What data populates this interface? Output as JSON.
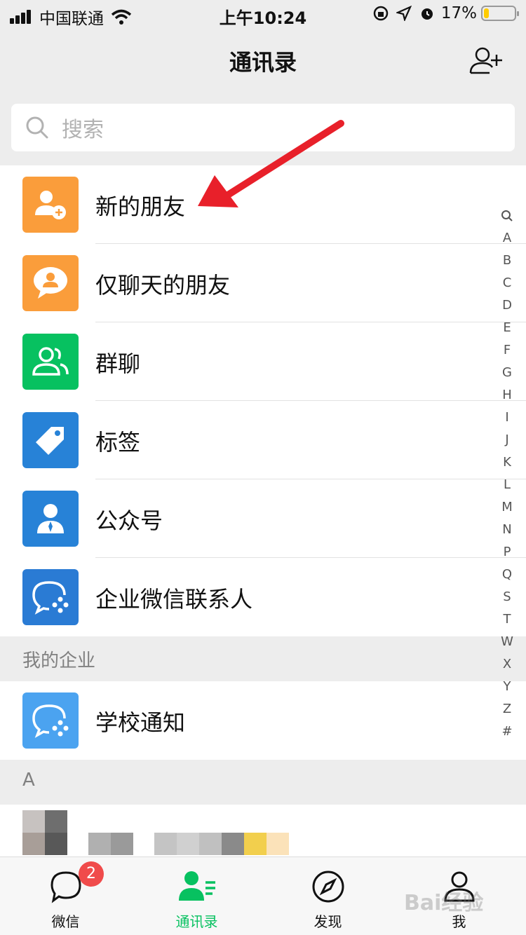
{
  "status_bar": {
    "carrier": "中国联通",
    "time": "上午10:24",
    "battery": "17%",
    "battery_level": 0.17,
    "battery_color": "#ffcc00"
  },
  "header": {
    "title": "通讯录",
    "add_icon": "add-contact-icon"
  },
  "search": {
    "placeholder": "搜索"
  },
  "top_items": [
    {
      "label": "新的朋友",
      "icon": "new-friend-icon",
      "color": "#fa9d3b"
    },
    {
      "label": "仅聊天的朋友",
      "icon": "chat-only-friend-icon",
      "color": "#fa9d3b"
    },
    {
      "label": "群聊",
      "icon": "group-chat-icon",
      "color": "#07c160"
    },
    {
      "label": "标签",
      "icon": "tag-icon",
      "color": "#2782d7"
    },
    {
      "label": "公众号",
      "icon": "official-account-icon",
      "color": "#2782d7"
    },
    {
      "label": "企业微信联系人",
      "icon": "wecom-icon",
      "color": "#2a7bd4"
    }
  ],
  "enterprise_section": {
    "title": "我的企业",
    "items": [
      {
        "label": "学校通知",
        "icon": "wecom-icon",
        "color": "#4ba3f0"
      }
    ]
  },
  "letter_section": {
    "title": "A"
  },
  "index_bar": [
    "A",
    "B",
    "C",
    "D",
    "E",
    "F",
    "G",
    "H",
    "I",
    "J",
    "K",
    "L",
    "M",
    "N",
    "P",
    "Q",
    "S",
    "T",
    "W",
    "X",
    "Y",
    "Z",
    "#"
  ],
  "tabbar": {
    "tabs": [
      {
        "label": "微信",
        "icon": "chat-bubble-icon",
        "badge": "2",
        "active": false
      },
      {
        "label": "通讯录",
        "icon": "contacts-icon",
        "active": true
      },
      {
        "label": "发现",
        "icon": "compass-icon",
        "active": false
      },
      {
        "label": "我",
        "icon": "person-icon",
        "active": false
      }
    ],
    "active_color": "#07c160"
  },
  "watermark": "Bai经验"
}
